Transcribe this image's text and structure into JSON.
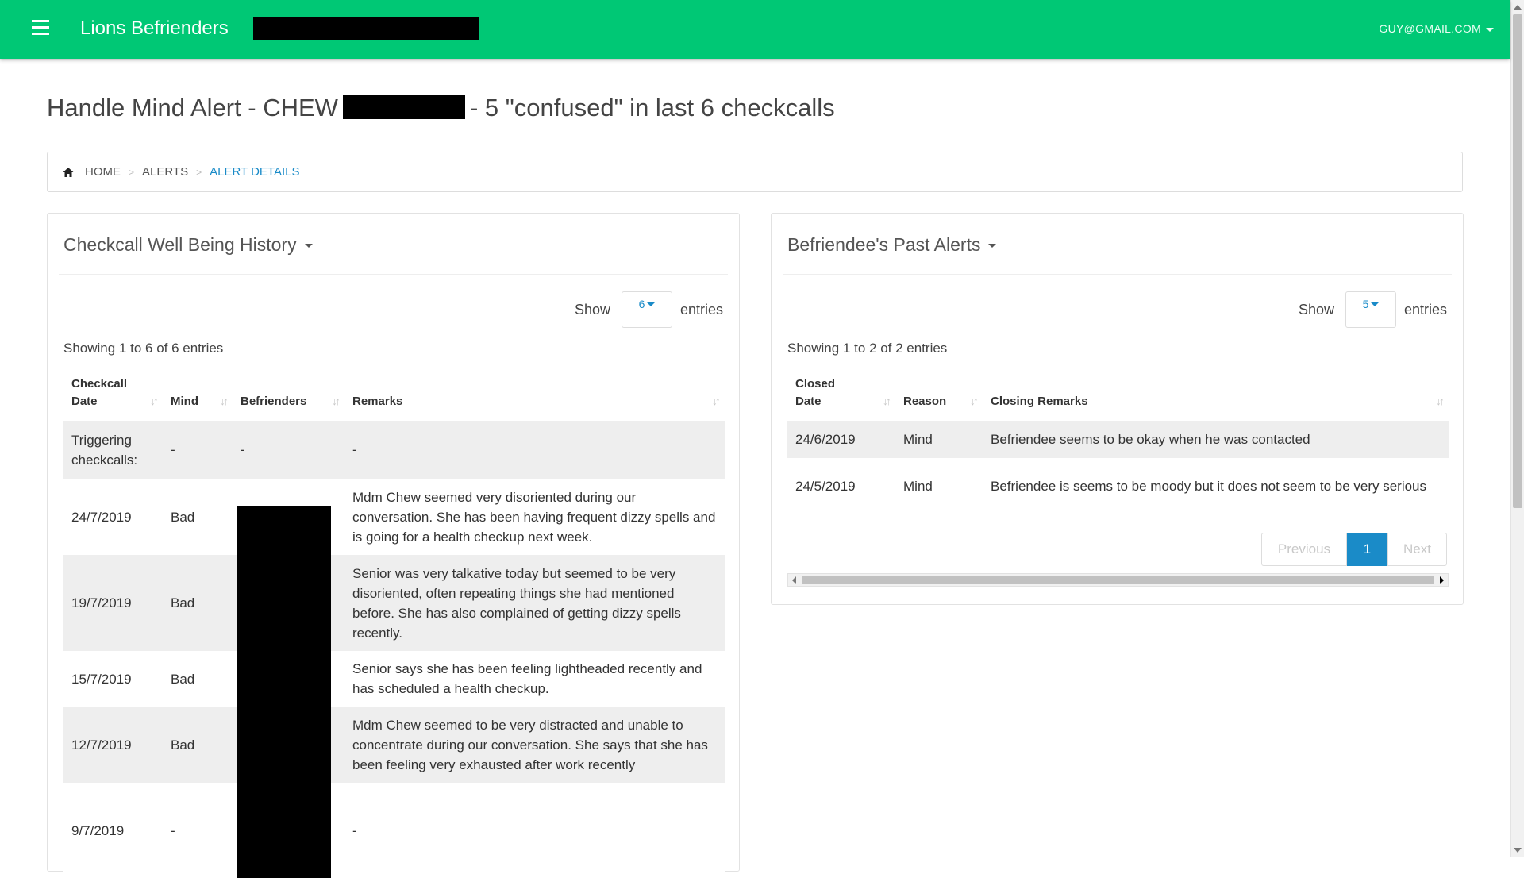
{
  "navbar": {
    "brand": "Lions Befrienders",
    "user": "GUY@GMAIL.COM"
  },
  "page": {
    "title_prefix": "Handle Mind Alert - CHEW",
    "title_suffix": "- 5 \"confused\" in last 6 checkcalls"
  },
  "breadcrumb": {
    "home": "HOME",
    "alerts": "ALERTS",
    "current": "ALERT DETAILS"
  },
  "left_panel": {
    "title": "Checkcall Well Being History",
    "show_label": "Show",
    "show_value": "6",
    "entries_label": "entries",
    "showing": "Showing 1 to 6 of 6 entries",
    "headers": {
      "date": "Checkcall Date",
      "mind": "Mind",
      "befrienders": "Befrienders",
      "remarks": "Remarks"
    },
    "rows": [
      {
        "date": "Triggering checkcalls:",
        "mind": "-",
        "befrienders": "-",
        "remarks": "-"
      },
      {
        "date": "24/7/2019",
        "mind": "Bad",
        "befrienders": "",
        "remarks": "Mdm Chew seemed very disoriented during our conversation. She has been having frequent dizzy spells and is going for a health checkup next week."
      },
      {
        "date": "19/7/2019",
        "mind": "Bad",
        "befrienders": "",
        "remarks": "Senior was very talkative today but seemed to be very disoriented, often repeating things she had mentioned before. She has also complained of getting dizzy spells recently."
      },
      {
        "date": "15/7/2019",
        "mind": "Bad",
        "befrienders": "",
        "remarks": "Senior says she has been feeling lightheaded recently and has scheduled a health checkup."
      },
      {
        "date": "12/7/2019",
        "mind": "Bad",
        "befrienders": "",
        "remarks": "Mdm Chew seemed to be very distracted and unable to concentrate during our conversation. She says that she has been feeling very exhausted after work recently"
      },
      {
        "date": "9/7/2019",
        "mind": "-",
        "befrienders": "",
        "remarks": "-"
      }
    ]
  },
  "right_panel": {
    "title": "Befriendee's Past Alerts",
    "show_label": "Show",
    "show_value": "5",
    "entries_label": "entries",
    "showing": "Showing 1 to 2 of 2 entries",
    "headers": {
      "date": "Closed Date",
      "reason": "Reason",
      "remarks": "Closing Remarks"
    },
    "rows": [
      {
        "date": "24/6/2019",
        "reason": "Mind",
        "remarks": "Befriendee seems to be okay when he was contacted"
      },
      {
        "date": "24/5/2019",
        "reason": "Mind",
        "remarks": "Befriendee is seems to be moody but it does not seem to be very serious"
      }
    ],
    "pagination": {
      "previous": "Previous",
      "current": "1",
      "next": "Next"
    }
  },
  "colors": {
    "navbar": "#00c875",
    "link": "#1a8bc8",
    "stripe": "#eeeeee"
  }
}
